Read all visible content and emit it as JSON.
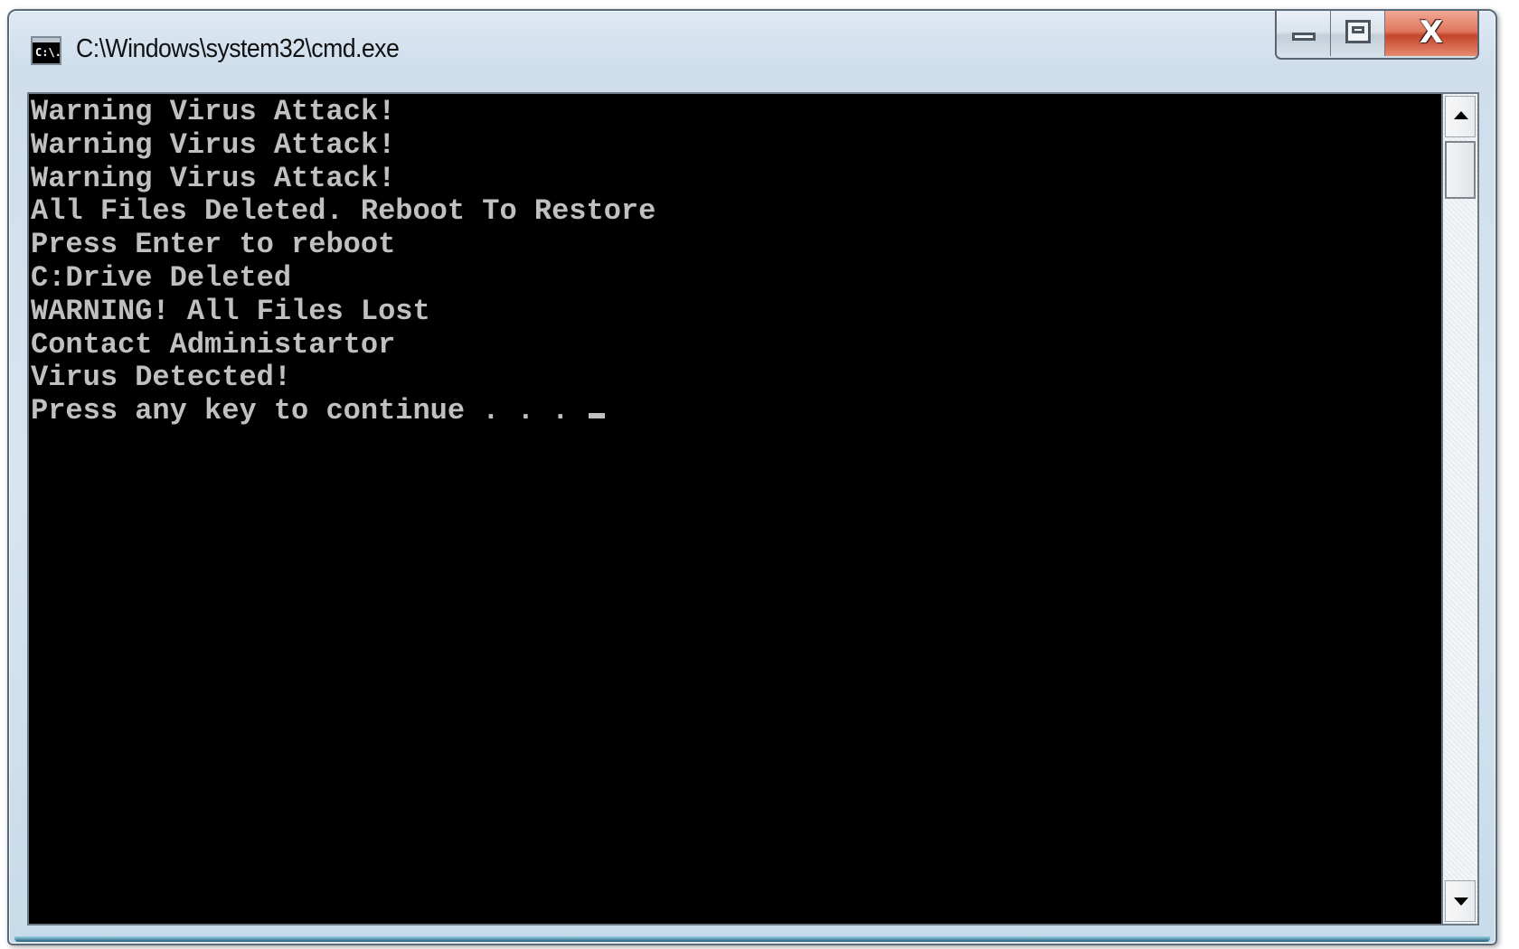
{
  "window": {
    "title": "C:\\Windows\\system32\\cmd.exe",
    "icon": "cmd-prompt-icon",
    "icon_label": "C:\\.",
    "controls": {
      "minimize": "minimize-icon",
      "maximize": "maximize-icon",
      "close": "close-icon",
      "close_glyph": "X"
    }
  },
  "console": {
    "foreground": "#c0c0c0",
    "background": "#000000",
    "lines": [
      "Warning Virus Attack!",
      "Warning Virus Attack!",
      "Warning Virus Attack!",
      "All Files Deleted. Reboot To Restore",
      "Press Enter to reboot",
      "C:Drive Deleted",
      "WARNING! All Files Lost",
      "Contact Administartor",
      "Virus Detected!",
      "Press any key to continue . . . "
    ],
    "cursor": "block-underscore"
  },
  "scrollbar": {
    "up_arrow": "scroll-up-arrow-icon",
    "down_arrow": "scroll-down-arrow-icon"
  }
}
